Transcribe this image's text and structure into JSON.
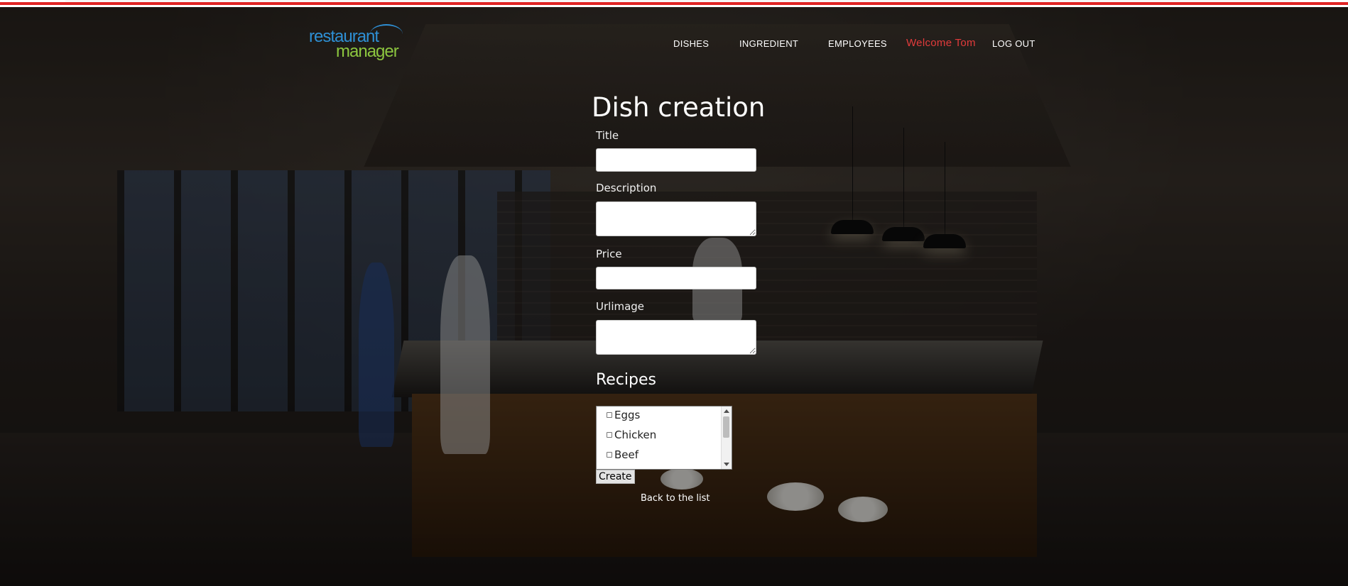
{
  "header": {
    "logo_line1": "restaurant",
    "logo_line2": "manager",
    "nav": {
      "dishes": "DISHES",
      "ingredient": "INGREDIENT",
      "employees": "EMPLOYEES",
      "welcome": "Welcome Tom",
      "logout": "LOG OUT"
    }
  },
  "form": {
    "title": "Dish creation",
    "fields": {
      "title_label": "Title",
      "title_value": "",
      "description_label": "Description",
      "description_value": "",
      "price_label": "Price",
      "price_value": "",
      "urlimage_label": "Urlimage",
      "urlimage_value": ""
    },
    "recipes_heading": "Recipes",
    "recipes": [
      "Eggs",
      "Chicken",
      "Beef"
    ],
    "create_label": "Create",
    "back_link": "Back to the list"
  },
  "colors": {
    "top_accent": "#e02424",
    "logo_blue": "#2e8fd4",
    "logo_green": "#8cc63f",
    "welcome_red": "#e23b3b"
  }
}
